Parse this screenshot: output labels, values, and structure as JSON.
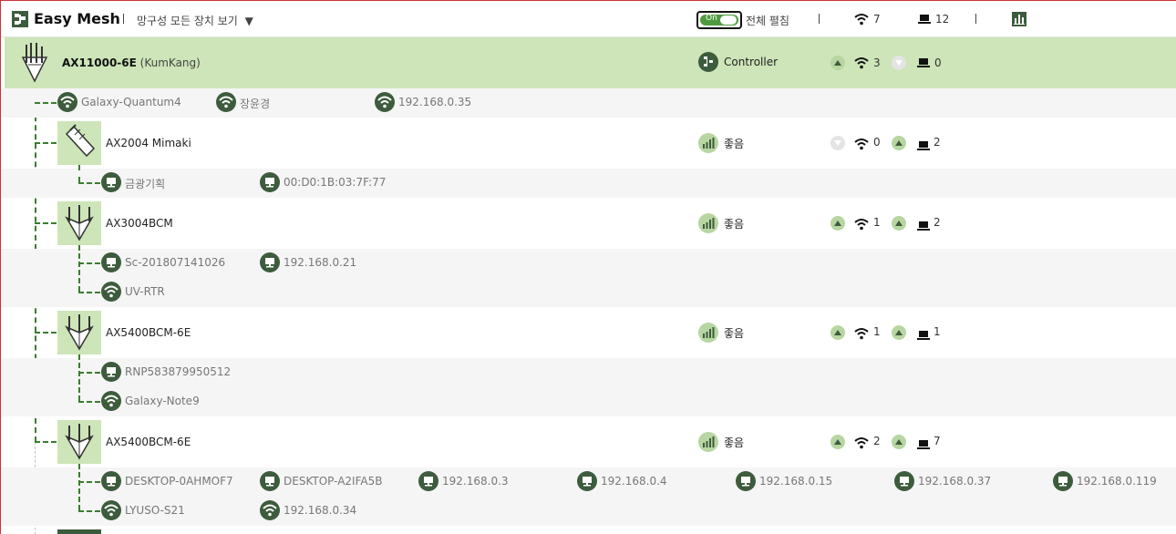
{
  "header": {
    "title": "Easy Mesh",
    "view_label": "망구성 모든 장치 보기",
    "toggle_text": "On",
    "expand_all": "전체 펼침",
    "wifi_count": "7",
    "pc_count": "12"
  },
  "controller": {
    "model": "AX11000-6E",
    "owner": "(KumKang)",
    "role": "Controller",
    "wifi": "3",
    "pc": "0"
  },
  "controller_clients": [
    {
      "name": "Galaxy-Quantum4",
      "type": "wifi"
    },
    {
      "name": "장윤경",
      "type": "wifi"
    },
    {
      "name": "192.168.0.35",
      "type": "wifi"
    }
  ],
  "nodes": [
    {
      "name": "AX2004 Mimaki",
      "signal": "좋음",
      "wifi": "0",
      "pc": "2",
      "client_rows": [
        [
          {
            "name": "금광기획",
            "type": "pc"
          },
          {
            "name": "00:D0:1B:03:7F:77",
            "type": "pc"
          }
        ]
      ]
    },
    {
      "name": "AX3004BCM",
      "signal": "좋음",
      "wifi": "1",
      "pc": "2",
      "client_rows": [
        [
          {
            "name": "Sc-201807141026",
            "type": "pc"
          },
          {
            "name": "192.168.0.21",
            "type": "pc"
          }
        ],
        [
          {
            "name": "UV-RTR",
            "type": "wifi"
          }
        ]
      ]
    },
    {
      "name": "AX5400BCM-6E",
      "signal": "좋음",
      "wifi": "1",
      "pc": "1",
      "client_rows": [
        [
          {
            "name": "RNP583879950512",
            "type": "pc"
          }
        ],
        [
          {
            "name": "Galaxy-Note9",
            "type": "wifi"
          }
        ]
      ]
    },
    {
      "name": "AX5400BCM-6E",
      "signal": "좋음",
      "wifi": "2",
      "pc": "7",
      "client_rows": [
        [
          {
            "name": "DESKTOP-0AHMOF7",
            "type": "pc"
          },
          {
            "name": "DESKTOP-A2IFA5B",
            "type": "pc"
          },
          {
            "name": "192.168.0.3",
            "type": "pc"
          },
          {
            "name": "192.168.0.4",
            "type": "pc"
          },
          {
            "name": "192.168.0.15",
            "type": "pc"
          },
          {
            "name": "192.168.0.37",
            "type": "pc"
          },
          {
            "name": "192.168.0.119",
            "type": "pc"
          }
        ],
        [
          {
            "name": "LYUSO-S21",
            "type": "wifi"
          },
          {
            "name": "192.168.0.34",
            "type": "wifi"
          }
        ]
      ]
    }
  ]
}
